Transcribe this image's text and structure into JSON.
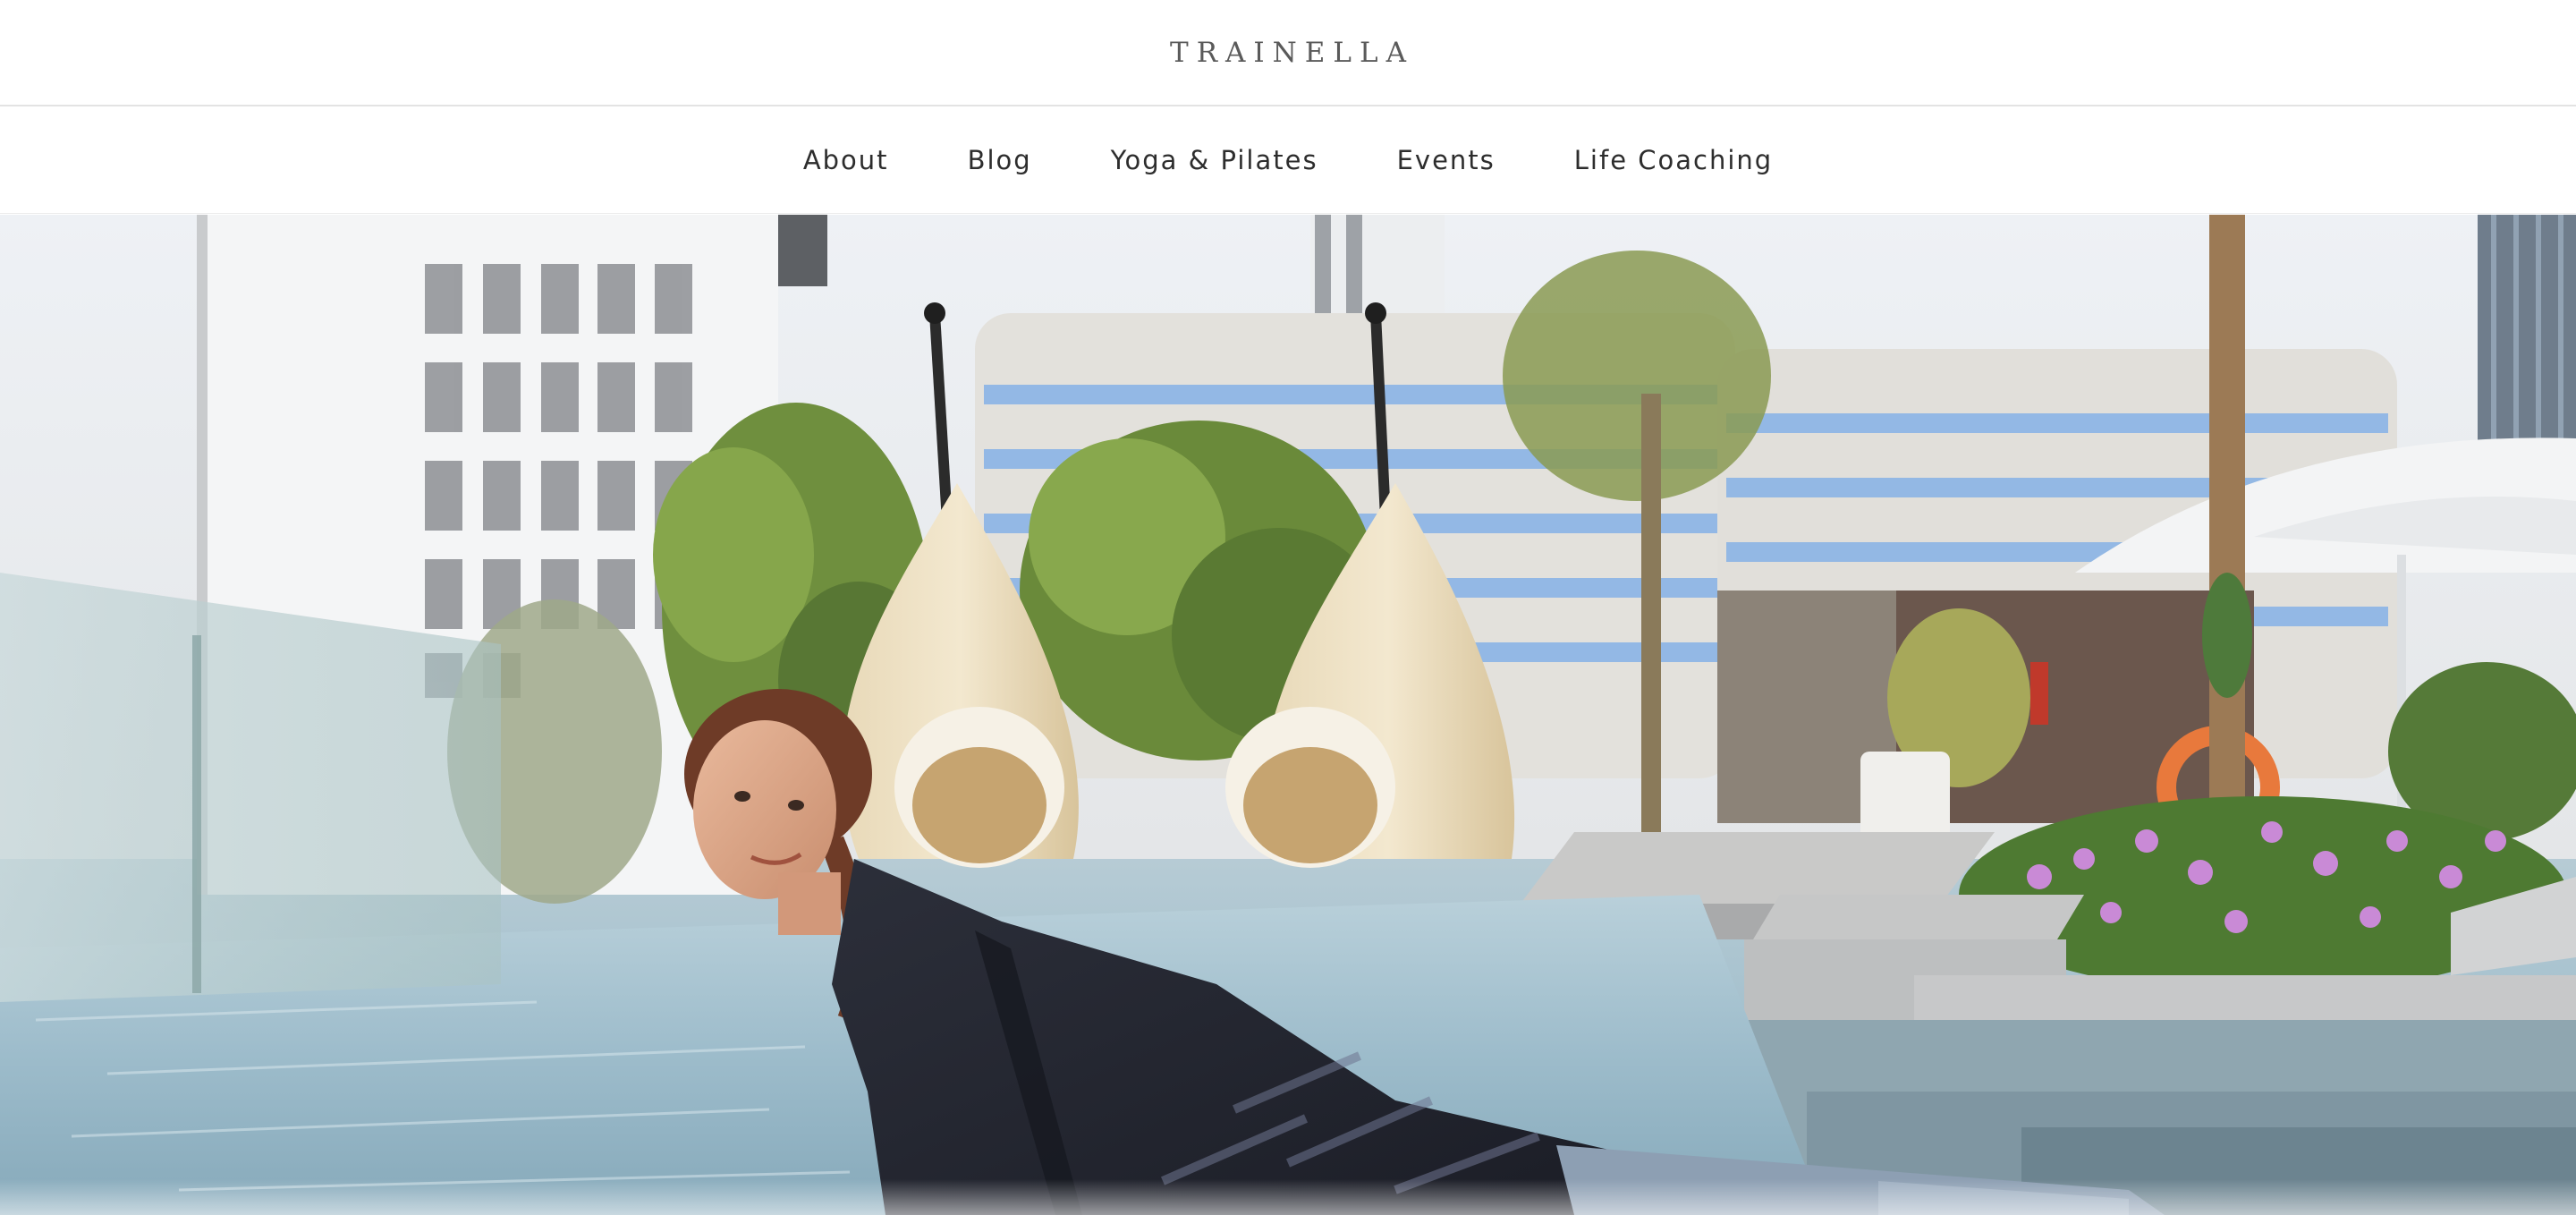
{
  "site": {
    "logo_text": "TRAINELLA"
  },
  "nav": {
    "items": [
      {
        "label": "About"
      },
      {
        "label": "Blog"
      },
      {
        "label": "Yoga & Pilates"
      },
      {
        "label": "Events"
      },
      {
        "label": "Life Coaching"
      }
    ]
  },
  "hero": {
    "image_subject": "woman-stretching-poolside-photo"
  },
  "colors": {
    "logo": "#5a5a5a",
    "nav_text": "#2d2d2d",
    "divider": "#e3e3e3",
    "background": "#ffffff"
  }
}
